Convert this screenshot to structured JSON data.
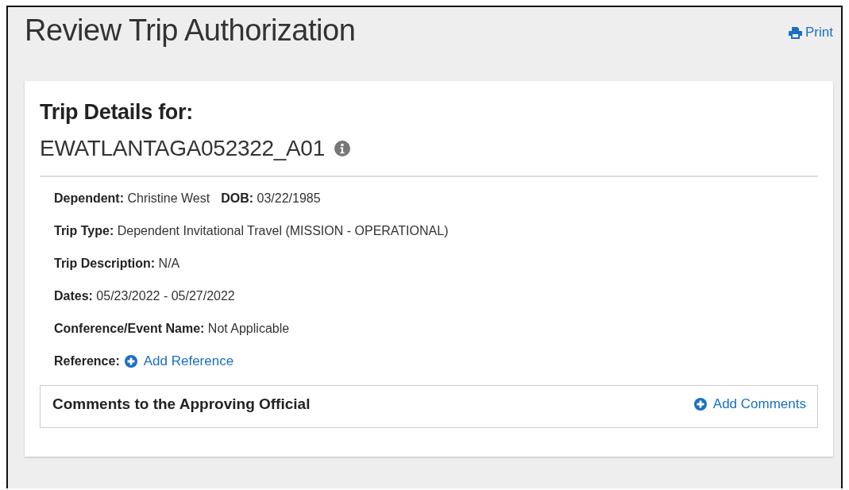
{
  "page": {
    "title": "Review Trip Authorization",
    "print_link": "Print"
  },
  "card": {
    "heading": "Trip Details for:",
    "trip_id": "EWATLANTAGA052322_A01",
    "details": [
      {
        "kind": "text",
        "pairs": [
          {
            "label": "Dependent:",
            "value": "Christine West"
          },
          {
            "label": "DOB:",
            "value": "03/22/1985"
          }
        ]
      },
      {
        "kind": "text",
        "pairs": [
          {
            "label": "Trip Type:",
            "value": "Dependent Invitational Travel (MISSION - OPERATIONAL)"
          }
        ]
      },
      {
        "kind": "text",
        "pairs": [
          {
            "label": "Trip Description:",
            "value": "N/A"
          }
        ]
      },
      {
        "kind": "text",
        "pairs": [
          {
            "label": "Dates:",
            "value": "05/23/2022 - 05/27/2022"
          }
        ]
      },
      {
        "kind": "text",
        "pairs": [
          {
            "label": "Conference/Event Name:",
            "value": "Not Applicable"
          }
        ]
      },
      {
        "kind": "link",
        "label": "Reference:",
        "link": "Add Reference"
      }
    ],
    "comments": {
      "title": "Comments to the Approving Official",
      "link": "Add Comments"
    }
  }
}
